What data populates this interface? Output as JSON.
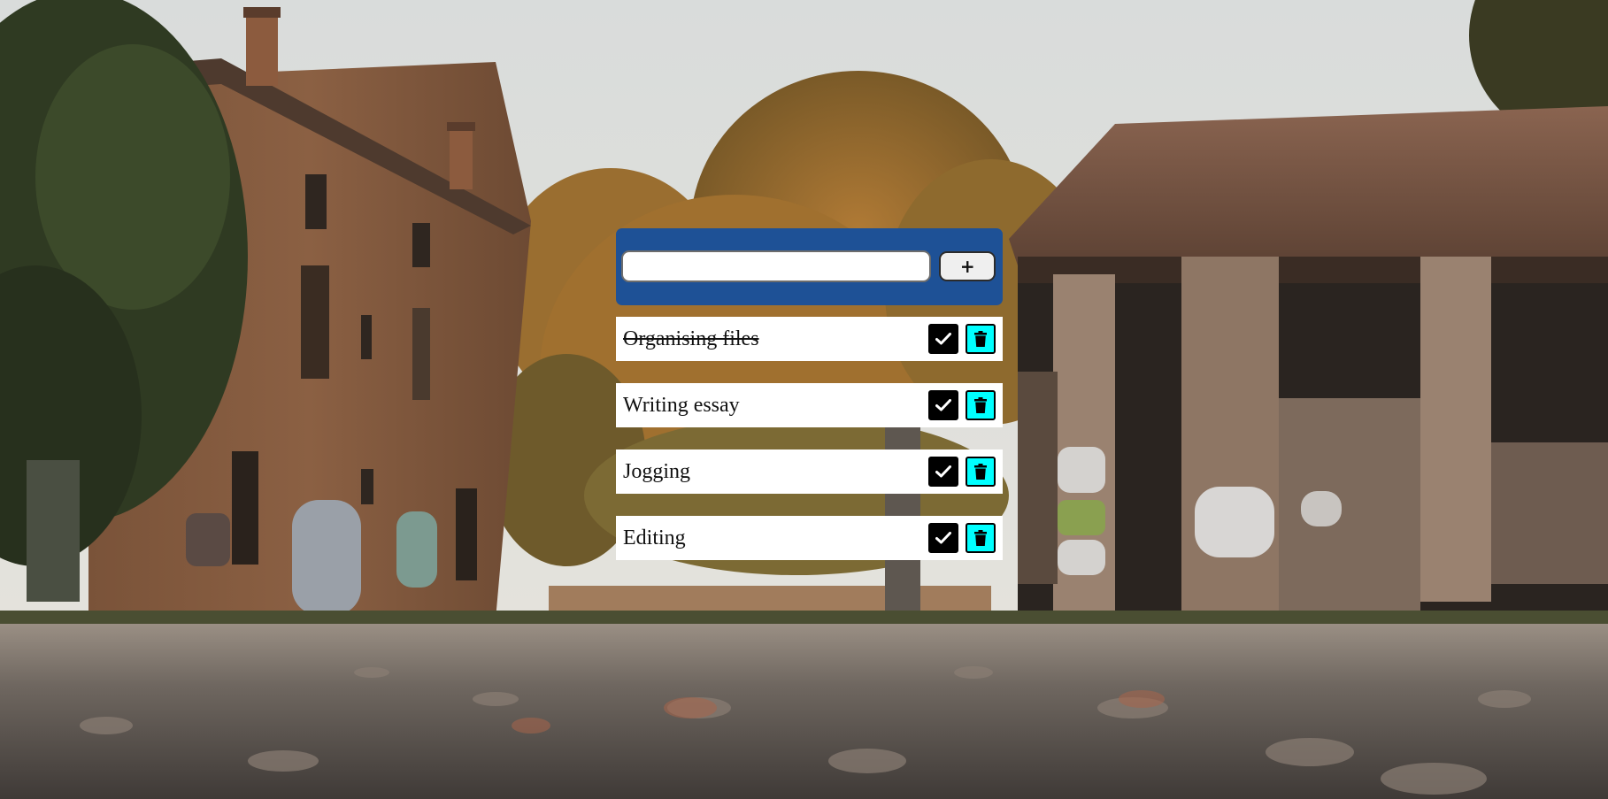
{
  "form": {
    "input_value": "",
    "input_placeholder": "",
    "add_label": "+"
  },
  "todos": [
    {
      "text": "Organising files",
      "completed": true
    },
    {
      "text": "Writing essay",
      "completed": false
    },
    {
      "text": "Jogging",
      "completed": false
    },
    {
      "text": "Editing",
      "completed": false
    }
  ],
  "icons": {
    "add": "plus-icon",
    "complete": "check-icon",
    "delete": "trash-icon"
  },
  "colors": {
    "header_bg": "#1e5196",
    "complete_bg": "#000000",
    "delete_bg": "#00ffff",
    "item_bg": "#ffffff"
  }
}
